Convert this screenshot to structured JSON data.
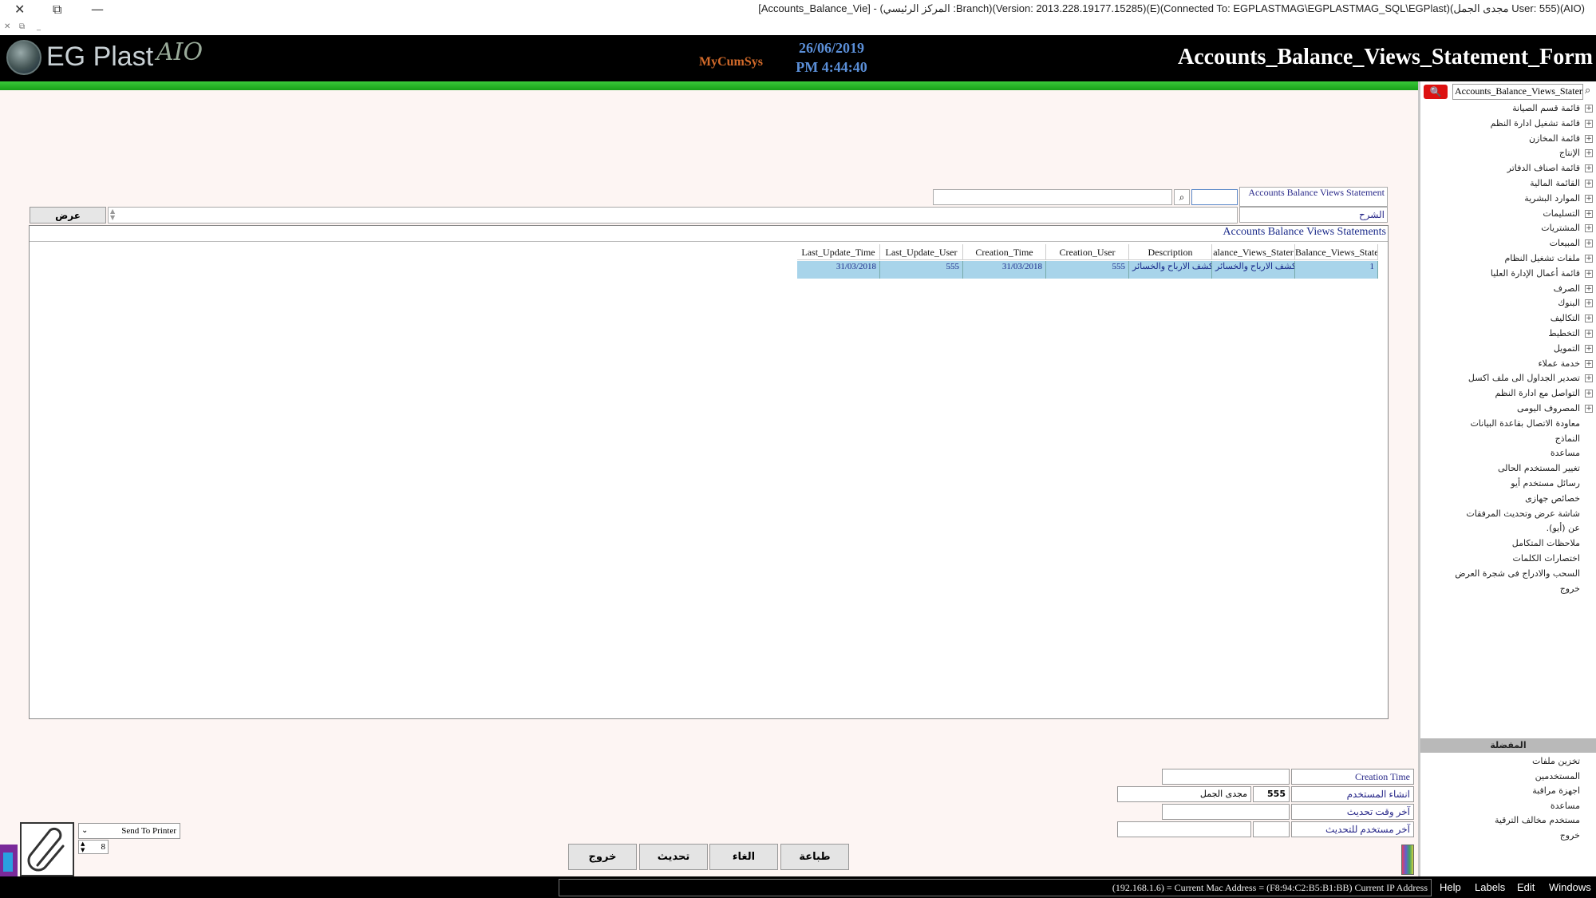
{
  "window": {
    "title": "[Accounts_Balance_Vie] - (المركز الرئيسي :Branch)(Version: 2013.228.19177.15285)(E)(Connected To: EGPLASTMAG\\EGPLASTMAG_SQL\\EGPlast)(مجدى الجمل User: 555)(AIO)"
  },
  "header": {
    "logo_text": "EG Plast",
    "logo_suffix": "AIO",
    "brand": "MyCumSys",
    "date": "26/06/2019",
    "time": "PM 4:44:40",
    "form_name": "Accounts_Balance_Views_Statement_Form"
  },
  "right_panel": {
    "search_value": "Accounts_Balance_Views_Statement_Form",
    "menu_items": [
      {
        "label": "قائمة قسم الصيانة",
        "expandable": true
      },
      {
        "label": "قائمة تشغيل ادارة النظم",
        "expandable": true
      },
      {
        "label": "قائمة المخازن",
        "expandable": true
      },
      {
        "label": "الإنتاج",
        "expandable": true
      },
      {
        "label": "قائمة اصناف الدفاتر",
        "expandable": true
      },
      {
        "label": "القائمة المالية",
        "expandable": true
      },
      {
        "label": "الموارد البشرية",
        "expandable": true
      },
      {
        "label": "التسليمات",
        "expandable": true
      },
      {
        "label": "المشتريات",
        "expandable": true
      },
      {
        "label": "المبيعات",
        "expandable": true
      },
      {
        "label": "ملفات تشغيل النظام",
        "expandable": true
      },
      {
        "label": "قائمة أعمال الإدارة العليا",
        "expandable": true
      },
      {
        "label": "الصرف",
        "expandable": true
      },
      {
        "label": "البنوك",
        "expandable": true
      },
      {
        "label": "التكاليف",
        "expandable": true
      },
      {
        "label": "التخطيط",
        "expandable": true
      },
      {
        "label": "التمويل",
        "expandable": true
      },
      {
        "label": "خدمة عملاء",
        "expandable": true
      },
      {
        "label": "تصدير الجداول الى ملف اكسل",
        "expandable": true
      },
      {
        "label": "التواصل مع ادارة النظم",
        "expandable": true
      },
      {
        "label": "المصروف اليومى",
        "expandable": true
      },
      {
        "label": "معاودة الاتصال بقاعدة البيانات",
        "expandable": false
      },
      {
        "label": "النماذج",
        "expandable": false
      },
      {
        "label": "مساعدة",
        "expandable": false
      },
      {
        "label": "تغيير المستخدم الحالى",
        "expandable": false
      },
      {
        "label": "رسائل مستخدم أيو",
        "expandable": false
      },
      {
        "label": "خصائص جهازى",
        "expandable": false
      },
      {
        "label": "شاشة عرض وتحديث المرفقات",
        "expandable": false
      },
      {
        "label": "عن (أيو).",
        "expandable": false
      },
      {
        "label": "ملاحظات المتكامل",
        "expandable": false
      },
      {
        "label": "اختصارات الكلمات",
        "expandable": false
      },
      {
        "label": "السحب والادراج فى شجرة العرض",
        "expandable": false
      },
      {
        "label": "خروج",
        "expandable": false
      }
    ],
    "favorites_title": "المفضلة",
    "favorites": [
      "تخزين ملفات",
      "المستخدمين",
      "اجهزة مراقبة",
      "مساعدة",
      "مستخدم مخالف الترقية",
      "خروج"
    ]
  },
  "filter": {
    "caption": "Accounts Balance Views Statement",
    "search_value": "",
    "search_text": "",
    "desc_label": "الشرح",
    "desc_value": "",
    "show_button": "عرض"
  },
  "grid": {
    "title": "Accounts Balance Views Statements",
    "columns": [
      "Balance_Views_State",
      "alance_Views_Stater",
      "Description",
      "Creation_User",
      "Creation_Time",
      "Last_Update_User",
      "Last_Update_Time"
    ],
    "rows": [
      [
        "1",
        "كشف الارباح والخسائر",
        "كشف الارباح والخسائر",
        "555",
        "31/03/2018",
        "555",
        "31/03/2018"
      ]
    ]
  },
  "bottom_form": {
    "creation_time_label": "Creation Time",
    "creation_time_value": "",
    "creator_label": "انشاء المستخدم",
    "creator_code": "555",
    "creator_name": "مجدى الجمل",
    "last_update_label": "آخر وقت تحديث",
    "last_update_value": "",
    "last_user_label": "آخر مستخدم للتحديث",
    "last_user_code": "",
    "last_user_name": ""
  },
  "printer": {
    "select_value": "Send To Printer",
    "copies": "8"
  },
  "buttons": {
    "print": "طباعة",
    "cancel": "الغاء",
    "update": "تحديث",
    "exit": "خروج"
  },
  "statusbar": {
    "text": "(192.168.1.6) = Current Mac Address = (F8:94:C2:B5:B1:BB) Current IP Address",
    "menus": [
      "Help",
      "Labels",
      "Edit",
      "Windows"
    ]
  },
  "colors": {
    "header_bg": "#000000",
    "accent_green": "#22b022",
    "row_highlight": "#a8d4ea",
    "label_blue": "#2a2a8a"
  }
}
